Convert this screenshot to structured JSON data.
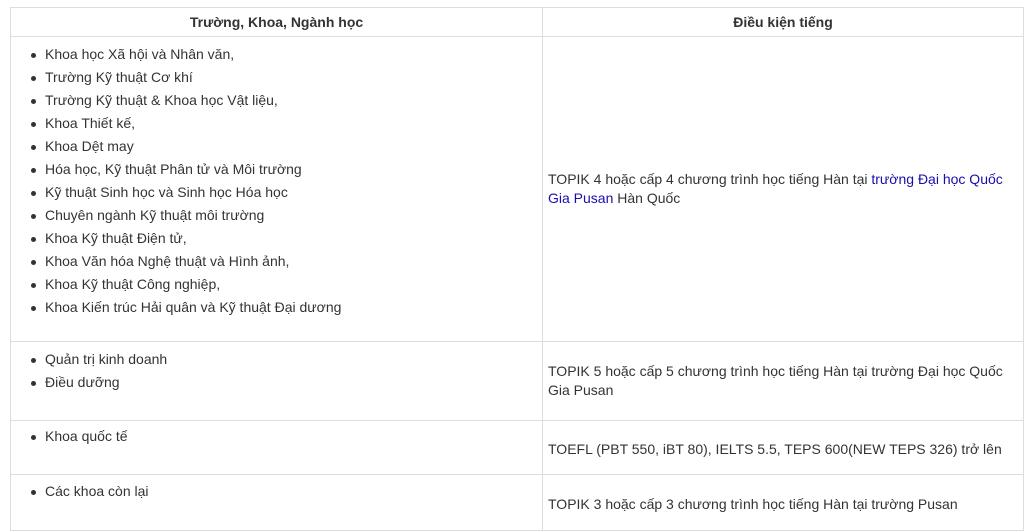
{
  "table": {
    "headers": [
      "Trường, Khoa, Ngành học",
      "Điều kiện tiếng"
    ],
    "rows": [
      {
        "items": [
          "Khoa học Xã hội và Nhân văn,",
          "Trường Kỹ thuật Cơ khí",
          "Trường Kỹ thuật & Khoa học Vật liệu,",
          "Khoa Thiết kế,",
          "Khoa Dệt may",
          "Hóa học, Kỹ thuật Phân tử và Môi trường",
          "Kỹ thuật Sinh học và Sinh học Hóa học",
          "Chuyên ngành Kỹ thuật môi trường",
          "Khoa Kỹ thuật Điện tử,",
          "Khoa Văn hóa Nghệ thuật và Hình ảnh,",
          "Khoa Kỹ thuật Công nghiệp,",
          "Khoa Kiến trúc Hải quân và Kỹ thuật Đại dương"
        ],
        "condition_before": "TOPIK 4 hoặc cấp 4 chương trình học tiếng Hàn tại ",
        "condition_link": "trường Đại học Quốc Gia Pusan",
        "condition_after": " Hàn Quốc"
      },
      {
        "items": [
          "Quản trị kinh doanh",
          "Điều dưỡng"
        ],
        "condition": "TOPIK 5 hoặc cấp 5 chương trình học tiếng Hàn tại trường Đại học Quốc Gia Pusan"
      },
      {
        "items": [
          "Khoa quốc tế"
        ],
        "condition": "TOEFL (PBT 550, iBT 80), IELTS 5.5, TEPS 600(NEW TEPS 326) trở lên"
      },
      {
        "items": [
          "Các khoa còn lại"
        ],
        "condition": "TOPIK 3 hoặc cấp 3 chương trình học tiếng Hàn tại trường Pusan"
      }
    ]
  }
}
